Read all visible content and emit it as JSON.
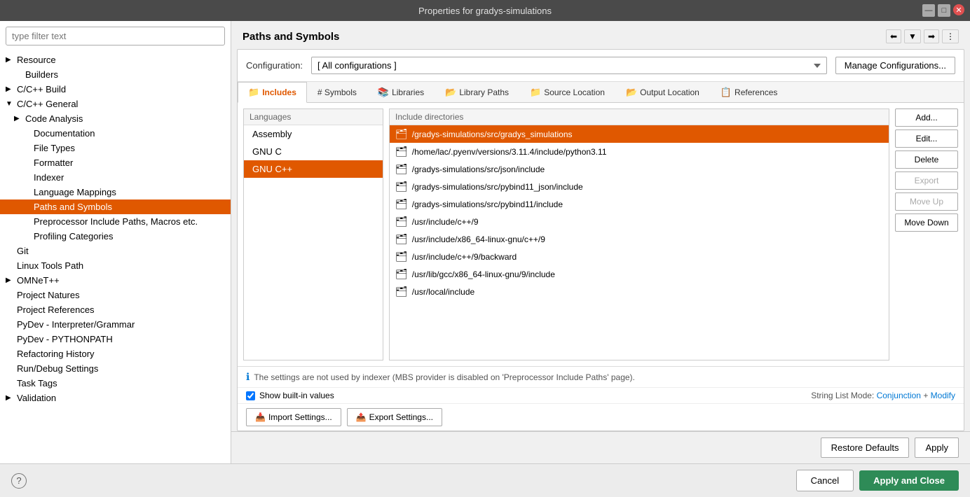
{
  "window": {
    "title": "Properties for gradys-simulations",
    "min_btn": "—",
    "max_btn": "□",
    "close_btn": "✕"
  },
  "sidebar": {
    "filter_placeholder": "type filter text",
    "items": [
      {
        "label": "Resource",
        "indent": 1,
        "has_arrow": true,
        "arrow": "▶"
      },
      {
        "label": "Builders",
        "indent": 2,
        "has_arrow": false
      },
      {
        "label": "C/C++ Build",
        "indent": 1,
        "has_arrow": true,
        "arrow": "▶"
      },
      {
        "label": "C/C++ General",
        "indent": 1,
        "has_arrow": true,
        "arrow": "▼"
      },
      {
        "label": "Code Analysis",
        "indent": 2,
        "has_arrow": true,
        "arrow": "▶"
      },
      {
        "label": "Documentation",
        "indent": 3,
        "has_arrow": false
      },
      {
        "label": "File Types",
        "indent": 3,
        "has_arrow": false
      },
      {
        "label": "Formatter",
        "indent": 3,
        "has_arrow": false
      },
      {
        "label": "Indexer",
        "indent": 3,
        "has_arrow": false
      },
      {
        "label": "Language Mappings",
        "indent": 3,
        "has_arrow": false
      },
      {
        "label": "Paths and Symbols",
        "indent": 3,
        "has_arrow": false,
        "selected": true
      },
      {
        "label": "Preprocessor Include Paths, Macros etc.",
        "indent": 3,
        "has_arrow": false
      },
      {
        "label": "Profiling Categories",
        "indent": 3,
        "has_arrow": false
      },
      {
        "label": "Git",
        "indent": 1,
        "has_arrow": false
      },
      {
        "label": "Linux Tools Path",
        "indent": 1,
        "has_arrow": false
      },
      {
        "label": "OMNeT++",
        "indent": 1,
        "has_arrow": true,
        "arrow": "▶"
      },
      {
        "label": "Project Natures",
        "indent": 1,
        "has_arrow": false
      },
      {
        "label": "Project References",
        "indent": 1,
        "has_arrow": false
      },
      {
        "label": "PyDev - Interpreter/Grammar",
        "indent": 1,
        "has_arrow": false
      },
      {
        "label": "PyDev - PYTHONPATH",
        "indent": 1,
        "has_arrow": false
      },
      {
        "label": "Refactoring History",
        "indent": 1,
        "has_arrow": false
      },
      {
        "label": "Run/Debug Settings",
        "indent": 1,
        "has_arrow": false
      },
      {
        "label": "Task Tags",
        "indent": 1,
        "has_arrow": false
      },
      {
        "label": "Validation",
        "indent": 1,
        "has_arrow": true,
        "arrow": "▶"
      }
    ]
  },
  "panel": {
    "title": "Paths and Symbols",
    "config_label": "Configuration:",
    "config_value": "[ All configurations ]",
    "manage_btn": "Manage Configurations...",
    "tabs": [
      {
        "id": "includes",
        "label": "Includes",
        "icon": "📁",
        "active": true
      },
      {
        "id": "symbols",
        "label": "# Symbols",
        "icon": "",
        "active": false
      },
      {
        "id": "libraries",
        "label": "Libraries",
        "icon": "📚",
        "active": false
      },
      {
        "id": "library-paths",
        "label": "Library Paths",
        "icon": "📂",
        "active": false
      },
      {
        "id": "source-location",
        "label": "Source Location",
        "icon": "📁",
        "active": false
      },
      {
        "id": "output-location",
        "label": "Output Location",
        "icon": "📂",
        "active": false
      },
      {
        "id": "references",
        "label": "References",
        "icon": "📋",
        "active": false
      }
    ],
    "languages_header": "Languages",
    "languages": [
      {
        "label": "Assembly",
        "selected": false
      },
      {
        "label": "GNU C",
        "selected": false
      },
      {
        "label": "GNU C++",
        "selected": true
      }
    ],
    "includes_header": "Include directories",
    "includes": [
      {
        "path": "/gradys-simulations/src/gradys_simulations",
        "selected": true
      },
      {
        "path": "/home/lac/.pyenv/versions/3.11.4/include/python3.11",
        "selected": false
      },
      {
        "path": "/gradys-simulations/src/json/include",
        "selected": false
      },
      {
        "path": "/gradys-simulations/src/pybind11_json/include",
        "selected": false
      },
      {
        "path": "/gradys-simulations/src/pybind11/include",
        "selected": false
      },
      {
        "path": "/usr/include/c++/9",
        "selected": false
      },
      {
        "path": "/usr/include/x86_64-linux-gnu/c++/9",
        "selected": false
      },
      {
        "path": "/usr/include/c++/9/backward",
        "selected": false
      },
      {
        "path": "/usr/lib/gcc/x86_64-linux-gnu/9/include",
        "selected": false
      },
      {
        "path": "/usr/local/include",
        "selected": false
      }
    ],
    "action_buttons": [
      {
        "id": "add",
        "label": "Add...",
        "disabled": false
      },
      {
        "id": "edit",
        "label": "Edit...",
        "disabled": false
      },
      {
        "id": "delete",
        "label": "Delete",
        "disabled": false
      },
      {
        "id": "export",
        "label": "Export",
        "disabled": true
      },
      {
        "id": "move-up",
        "label": "Move Up",
        "disabled": true
      },
      {
        "id": "move-down",
        "label": "Move Down",
        "disabled": false
      }
    ],
    "info_text": "The settings are not used by indexer (MBS provider is disabled on 'Preprocessor Include Paths' page).",
    "show_built_in_label": "Show built-in values",
    "string_list_label": "String List Mode:",
    "string_list_mode": "Conjunction",
    "string_list_modify": "Modify",
    "import_btn": "Import Settings...",
    "export_btn": "Export Settings...",
    "restore_defaults_btn": "Restore Defaults",
    "apply_btn": "Apply",
    "cancel_btn": "Cancel",
    "apply_close_btn": "Apply and Close",
    "help_icon": "?"
  }
}
